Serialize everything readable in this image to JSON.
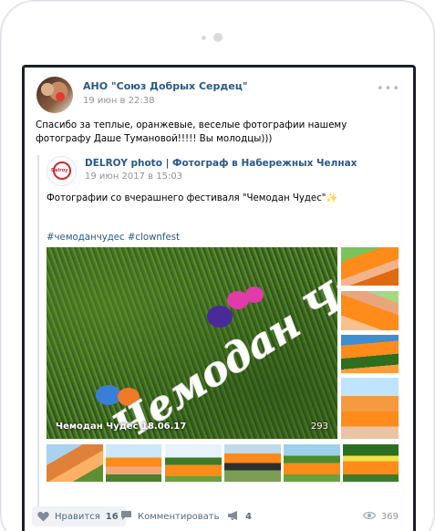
{
  "post": {
    "group_name": "АНО \"Союз Добрых Сердец\"",
    "date": "19 июн в 22:38",
    "text": "Спасибо за теплые, оранжевые, веселые фотографии нашему фотографу Даше Тумановой!!!!! Вы молодцы)))",
    "more_icon": "more-dots-icon"
  },
  "repost": {
    "author": "DELROY photo | Фотограф в Набережных Челнах",
    "avatar_text": "Delroy",
    "date": "19 июн 2017 в 15:03",
    "text": "Фотографии со вчерашнего фестиваля \"Чемодан Чудес\"",
    "sparkle": "✨",
    "hashtags": "#чемоданчудес #clownfest",
    "album_caption": "Чемодан Чудес 18.06.17",
    "album_count": "293",
    "photo_text": "Чемодан Чудес"
  },
  "actions": {
    "like_label": "Нравится",
    "like_count": "16",
    "comment_label": "Комментировать",
    "share_count": "4",
    "views_count": "369"
  },
  "colors": {
    "link": "#2a5885",
    "orange": "#ff8c1a"
  }
}
